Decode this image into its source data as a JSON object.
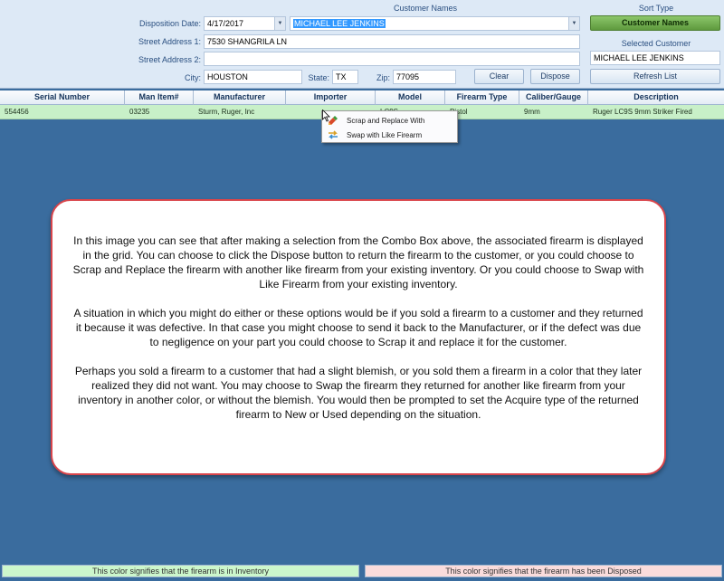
{
  "header": {
    "disposition_date_label": "Disposition Date:",
    "disposition_date_value": "4/17/2017",
    "customer_names_heading": "Customer Names",
    "customer_name_value": "MICHAEL LEE JENKINS",
    "street1_label": "Street Address 1:",
    "street1_value": "7530 SHANGRILA LN",
    "street2_label": "Street Address 2:",
    "street2_value": "",
    "city_label": "City:",
    "city_value": "HOUSTON",
    "state_label": "State:",
    "state_value": "TX",
    "zip_label": "Zip:",
    "zip_value": "77095",
    "clear_button": "Clear",
    "dispose_button": "Dispose",
    "sort_type_heading": "Sort Type",
    "sort_type_button": "Customer Names",
    "selected_customer_heading": "Selected Customer",
    "selected_customer_value": "MICHAEL LEE JENKINS",
    "refresh_button": "Refresh List"
  },
  "grid": {
    "columns": [
      "Serial Number",
      "Man Item#",
      "Manufacturer",
      "Importer",
      "Model",
      "Firearm Type",
      "Caliber/Gauge",
      "Description"
    ],
    "rows": [
      [
        "554456",
        "03235",
        "Sturm, Ruger, Inc",
        "",
        "LC9S",
        "Pistol",
        "9mm",
        "Ruger LC9S 9mm Striker Fired"
      ]
    ]
  },
  "context_menu": {
    "items": [
      "Scrap and Replace With",
      "Swap with Like Firearm"
    ]
  },
  "callout": {
    "paragraphs": [
      "In this image you can see that after making a selection from the Combo Box above, the associated firearm is displayed in the grid. You can choose to click the Dispose button to return the firearm to the customer, or you could choose to Scrap and Replace the firearm with another like firearm from your existing inventory. Or you could choose to Swap with Like Firearm from your existing inventory.",
      "A situation in which you might do either or these options would be if you sold a firearm to a customer and they returned it because it was defective. In that case you might choose to send it back to the Manufacturer, or if the defect was due to negligence on your part you could choose to Scrap it and replace it for the customer.",
      "Perhaps you sold a firearm to a customer that had a slight blemish, or you sold them a firearm in a color that they later realized they did not want. You may choose to Swap the firearm they returned for another like firearm from your inventory in another color, or without the blemish. You would then be prompted to set the Acquire type of the returned firearm to New or Used depending on the situation."
    ]
  },
  "footer": {
    "inventory_legend": "This color signifies that the firearm is in Inventory",
    "disposed_legend": "This color signifies that the firearm has been Disposed"
  },
  "colors": {
    "inventory": "#ccf7cc",
    "disposed": "#fadcdc",
    "grid_background": "#3a6c9e",
    "callout_border": "#d9454b"
  }
}
